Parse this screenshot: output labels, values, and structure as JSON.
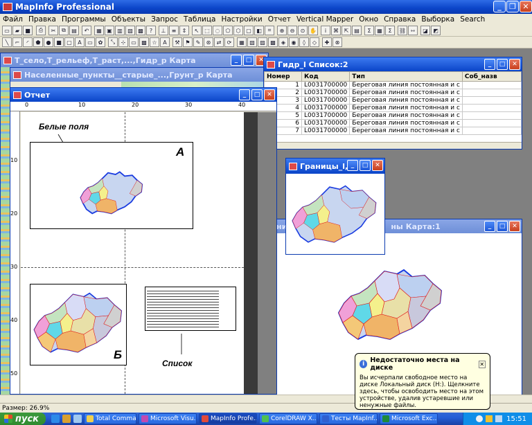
{
  "app": {
    "title": "MapInfo Professional"
  },
  "menu": [
    "Файл",
    "Правка",
    "Программы",
    "Объекты",
    "Запрос",
    "Таблица",
    "Настройки",
    "Отчет",
    "Vertical Mapper",
    "Окно",
    "Справка",
    "Выборка",
    "Search"
  ],
  "windows": {
    "map1": {
      "title": "Т_село,Т_рельеф,Т_раст,...,Гидр_р Карта"
    },
    "map2": {
      "title": "Населенные_пункты__старые_...,Грунт_р Карта"
    },
    "report": {
      "title": "Отчет"
    },
    "list": {
      "title": "Гидр_l Список:2"
    },
    "borders": {
      "title": "Границы_l,..."
    },
    "map3": {
      "title_fragment": "ни",
      "title_tail": "ны Карта:1"
    }
  },
  "list_table": {
    "columns": [
      "Номер",
      "Код",
      "Тип",
      "Соб_назв"
    ],
    "rows": [
      [
        "1",
        "L0031700000",
        "Береговая линия постоянная и с",
        ""
      ],
      [
        "2",
        "L0031700000",
        "Береговая линия постоянная и с",
        ""
      ],
      [
        "3",
        "L0031700000",
        "Береговая линия постоянная и с",
        ""
      ],
      [
        "4",
        "L0031700000",
        "Береговая линия постоянная и с",
        ""
      ],
      [
        "5",
        "L0031700000",
        "Береговая линия постоянная и с",
        ""
      ],
      [
        "6",
        "L0031700000",
        "Береговая линия постоянная и с",
        ""
      ],
      [
        "7",
        "L0031700000",
        "Береговая линия постоянная и с",
        ""
      ]
    ]
  },
  "report": {
    "ruler_top": [
      "0",
      "10",
      "20",
      "30",
      "40"
    ],
    "ruler_left": [
      "10",
      "20",
      "30",
      "40",
      "50"
    ],
    "label_white_fields": "Белые поля",
    "label_a": "А",
    "label_b": "Б",
    "label_list": "Список"
  },
  "status": {
    "size": "Размер: 26.9%"
  },
  "balloon": {
    "title": "Недостаточно места на диске",
    "body": "Вы исчерпали свободное место на диске Локальный диск (H:). Щелкните здесь, чтобы освободить место на этом устройстве, удалив устаревшие или ненужные файлы."
  },
  "taskbar": {
    "start": "пуск",
    "tasks": [
      "Total Comma...",
      "Microsoft Visu...",
      "MapInfo Profe...",
      "CorelDRAW X...",
      "Тесты MapInf...",
      "Microsoft Exc..."
    ],
    "time": "15:51"
  },
  "colors": {
    "map_border": "#1a3ce0",
    "map_red": "#e01818"
  }
}
